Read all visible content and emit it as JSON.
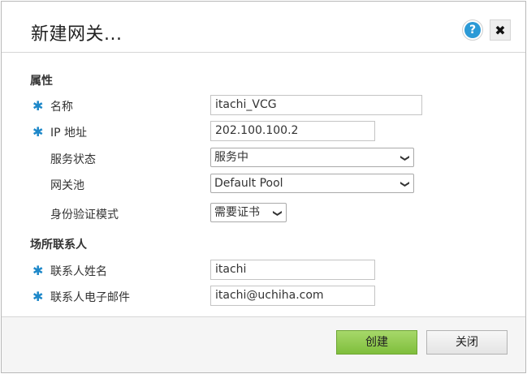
{
  "dialog": {
    "title": "新建网关...",
    "help_icon": "?",
    "close_icon": "✖"
  },
  "sections": {
    "properties": "属性",
    "site_contact": "场所联系人"
  },
  "fields": {
    "name": {
      "required": "✱",
      "label": "名称",
      "value": "itachi_VCG"
    },
    "ip": {
      "required": "✱",
      "label": "IP 地址",
      "value": "202.100.100.2"
    },
    "service_state": {
      "label": "服务状态",
      "selected": "服务中"
    },
    "gateway_pool": {
      "label": "网关池",
      "selected": "Default Pool"
    },
    "auth_mode": {
      "label": "身份验证模式",
      "selected": "需要证书"
    },
    "contact_name": {
      "required": "✱",
      "label": "联系人姓名",
      "value": "itachi"
    },
    "contact_email": {
      "required": "✱",
      "label": "联系人电子邮件",
      "value": "itachi@uchiha.com"
    }
  },
  "footer": {
    "create_label": "创建",
    "close_label": "关闭"
  },
  "colors": {
    "accent_required": "#1e88c9",
    "create_button": "#8cc84b",
    "help_icon": "#2c9ad6"
  }
}
